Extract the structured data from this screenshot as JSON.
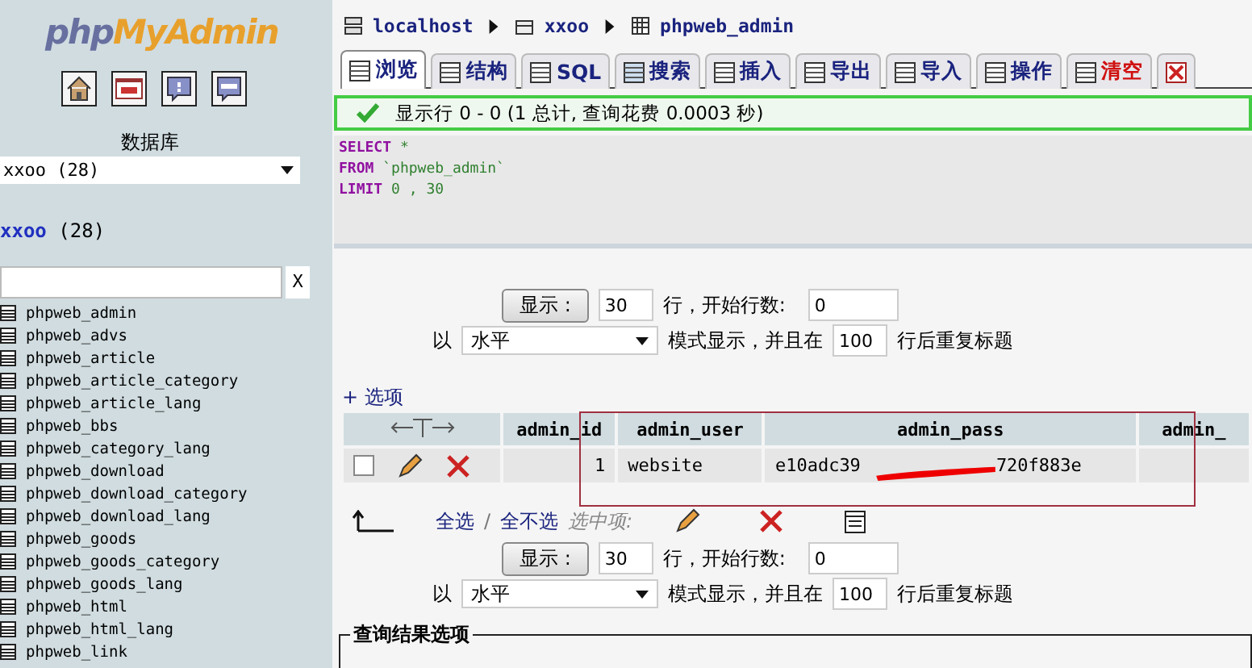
{
  "sidebar": {
    "logo": {
      "part1": "php",
      "part2": "MyAdmin"
    },
    "database_label": "数据库",
    "database_select": "xxoo (28)",
    "current_db": {
      "name": "xxoo",
      "count": "(28)"
    },
    "filter_clear": "X",
    "tables": [
      "phpweb_admin",
      "phpweb_advs",
      "phpweb_article",
      "phpweb_article_category",
      "phpweb_article_lang",
      "phpweb_bbs",
      "phpweb_category_lang",
      "phpweb_download",
      "phpweb_download_category",
      "phpweb_download_lang",
      "phpweb_goods",
      "phpweb_goods_category",
      "phpweb_goods_lang",
      "phpweb_html",
      "phpweb_html_lang",
      "phpweb_link"
    ]
  },
  "breadcrumb": [
    "localhost",
    "xxoo",
    "phpweb_admin"
  ],
  "tabs": [
    {
      "label": "浏览",
      "selected": true,
      "kind": "normal"
    },
    {
      "label": "结构",
      "selected": false,
      "kind": "normal"
    },
    {
      "label": "SQL",
      "selected": false,
      "kind": "normal"
    },
    {
      "label": "搜索",
      "selected": false,
      "kind": "normal"
    },
    {
      "label": "插入",
      "selected": false,
      "kind": "normal"
    },
    {
      "label": "导出",
      "selected": false,
      "kind": "normal"
    },
    {
      "label": "导入",
      "selected": false,
      "kind": "normal"
    },
    {
      "label": "操作",
      "selected": false,
      "kind": "normal"
    },
    {
      "label": "清空",
      "selected": false,
      "kind": "danger"
    }
  ],
  "message": "显示行 0 - 0 (1 总计, 查询花费 0.0003 秒)",
  "sql": [
    {
      "keyword": "SELECT",
      "rest": "*"
    },
    {
      "keyword": "FROM",
      "rest": "`phpweb_admin`"
    },
    {
      "keyword": "LIMIT",
      "rest": "0 , 30"
    }
  ],
  "navigation": [
    {
      "show_button": "显示 :",
      "rows": "30",
      "rows_label": "行，开始行数:",
      "start": "0",
      "mode_prefix": "以",
      "mode": "水平",
      "mode_label": "模式显示，并且在",
      "repeat": "100",
      "repeat_label": "行后重复标题"
    },
    {
      "show_button": "显示 :",
      "rows": "30",
      "rows_label": "行，开始行数:",
      "start": "0",
      "mode_prefix": "以",
      "mode": "水平",
      "mode_label": "模式显示，并且在",
      "repeat": "100",
      "repeat_label": "行后重复标题"
    }
  ],
  "options_link": "+ 选项",
  "table": {
    "columns": [
      "admin_id",
      "admin_user",
      "admin_pass",
      "admin_"
    ],
    "rows": [
      {
        "checked": false,
        "admin_id": "1",
        "admin_user": "website",
        "pass_start": "e10adc39",
        "pass_end": "720f883e"
      }
    ]
  },
  "bulk": {
    "check_all": "全选",
    "separator": "/",
    "uncheck_all": "全不选",
    "with_selected": "选中项:"
  },
  "results_fieldset": "查询结果选项"
}
